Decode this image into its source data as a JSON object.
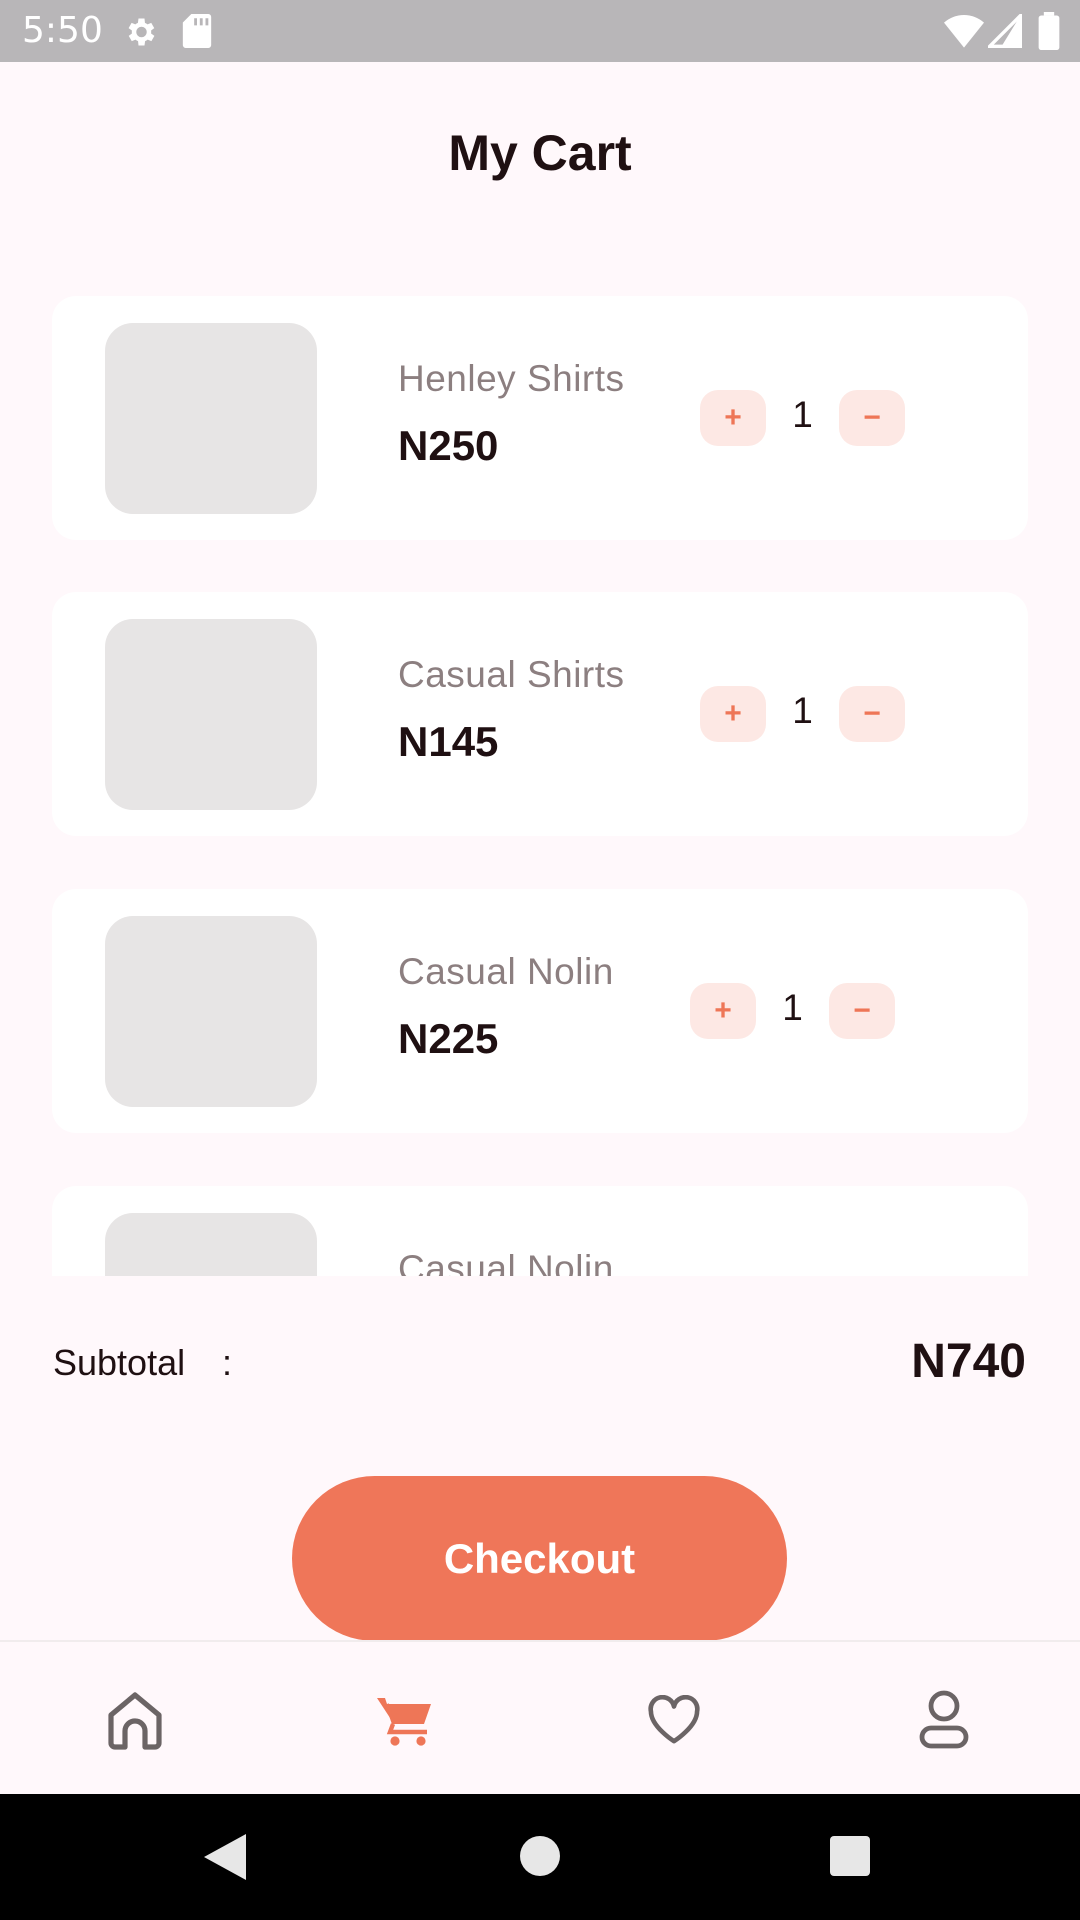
{
  "status_bar": {
    "time": "5:50"
  },
  "header": {
    "title": "My Cart"
  },
  "cart": {
    "items": [
      {
        "name": "Henley Shirts",
        "price": "N250",
        "quantity": "1",
        "plus": "+",
        "minus": "−"
      },
      {
        "name": "Casual Shirts",
        "price": "N145",
        "quantity": "1",
        "plus": "+",
        "minus": "−"
      },
      {
        "name": "Casual Nolin",
        "price": "N225",
        "quantity": "1",
        "plus": "+",
        "minus": "−"
      },
      {
        "name": "Casual Nolin",
        "price": "",
        "quantity": "",
        "plus": "",
        "minus": ""
      }
    ]
  },
  "summary": {
    "subtotal_label": "Subtotal",
    "colon": ":",
    "subtotal_value": "N740"
  },
  "checkout": {
    "label": "Checkout"
  },
  "nav": {
    "items": [
      {
        "icon": "home-icon"
      },
      {
        "icon": "cart-icon",
        "active": true
      },
      {
        "icon": "heart-icon"
      },
      {
        "icon": "profile-icon"
      }
    ],
    "colors": {
      "active": "#ee7657",
      "inactive": "#6b6465"
    }
  },
  "colors": {
    "accent": "#ef7659",
    "accent_soft": "#fde8e4",
    "background": "#fff8fb"
  }
}
